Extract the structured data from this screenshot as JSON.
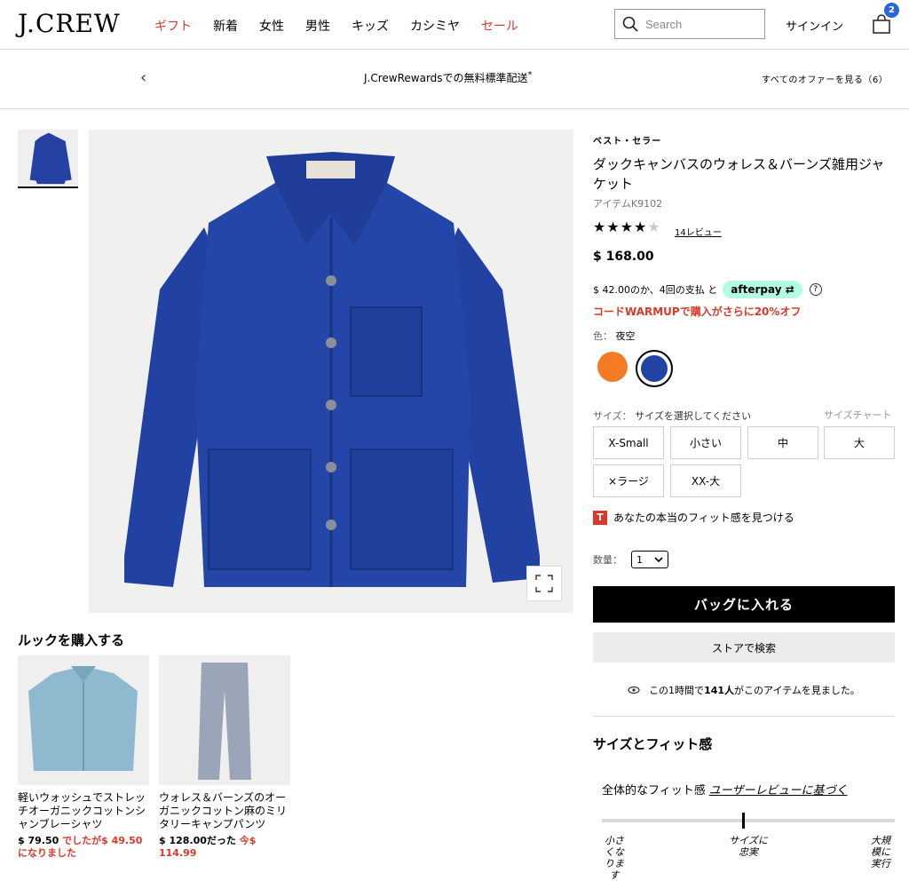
{
  "header": {
    "logo": "J.CREW",
    "nav": [
      {
        "label": "ギフト",
        "highlight": true
      },
      {
        "label": "新着",
        "highlight": false
      },
      {
        "label": "女性",
        "highlight": false
      },
      {
        "label": "男性",
        "highlight": false
      },
      {
        "label": "キッズ",
        "highlight": false
      },
      {
        "label": "カシミヤ",
        "highlight": false
      },
      {
        "label": "セール",
        "highlight": true
      }
    ],
    "search_placeholder": "Search",
    "signin": "サインイン",
    "bag_count": "2"
  },
  "promo": {
    "message": "J.CrewRewardsでの無料標準配送",
    "asterisk": "*",
    "offers": "すべてのオファーを見る（6）"
  },
  "product": {
    "badge": "ベスト・セラー",
    "title": "ダックキャンバスのウォレス＆バーンズ雑用ジャケット",
    "item": "アイテムK9102",
    "rating": 4,
    "rating_max": 5,
    "reviews": "14レビュー",
    "price": "$ 168.00",
    "afterpay_text": "$ 42.00のか、4回の支払 と",
    "afterpay_brand": "afterpay",
    "promo_code": "コードWARMUPで購入がさらに20%オフ",
    "color_label": "色：",
    "color_value": "夜空",
    "colors": [
      "#f47a23",
      "#2244a2"
    ],
    "size_label": "サイズ：",
    "size_prompt": "サイズを選択してください",
    "size_chart": "サイズチャート",
    "sizes": [
      "X-Small",
      "小さい",
      "中",
      "大",
      "×ラージ",
      "XX-大"
    ],
    "fit_finder": "あなたの本当のフィット感を見つける",
    "qty_label": "数量：",
    "qty_value": "1",
    "add_to_bag": "バッグに入れる",
    "find_in_store": "ストアで検索",
    "viewed_pre": "この1時間で",
    "viewed_count": "141人",
    "viewed_post": "がこのアイテムを見ました。"
  },
  "look": {
    "title": "ルックを購入する",
    "items": [
      {
        "name": "軽いウォッシュでストレッチオーガニックコットンシャンブレーシャツ",
        "price_was": "$ 79.50",
        "price_sale": "でしたが$ 49.50になりました"
      },
      {
        "name": "ウォレス＆バーンズのオーガニックコットン麻のミリタリーキャンプパンツ",
        "price_was": "$ 128.00だった",
        "price_sale": "今$ 114.99"
      }
    ]
  },
  "size_fit": {
    "title": "サイズとフィット感",
    "overall": "全体的なフィット感",
    "based_on": "ユーザーレビューに基づく",
    "labels": [
      "小さくなります",
      "サイズに忠実",
      "大規模に実行"
    ],
    "position": 0.5
  }
}
